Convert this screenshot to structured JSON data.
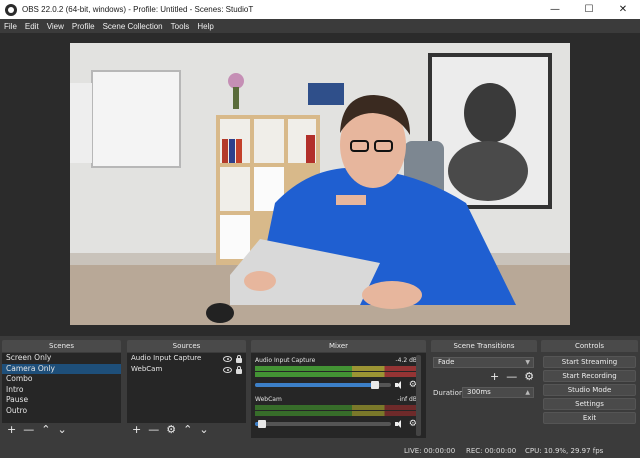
{
  "window": {
    "title": "OBS 22.0.2 (64-bit, windows) - Profile: Untitled - Scenes: StudioT",
    "minimize": "—",
    "maximize": "☐",
    "close": "✕"
  },
  "menu": [
    "File",
    "Edit",
    "View",
    "Profile",
    "Scene Collection",
    "Tools",
    "Help"
  ],
  "docks": {
    "scenes": {
      "title": "Scenes",
      "items": [
        "Screen Only",
        "Camera Only",
        "Combo",
        "Intro",
        "Pause",
        "Outro"
      ],
      "selected": "Camera Only"
    },
    "sources": {
      "title": "Sources",
      "items": [
        "Audio Input Capture",
        "WebCam"
      ]
    },
    "mixer": {
      "title": "Mixer",
      "channels": [
        {
          "name": "Audio Input Capture",
          "level": "-4.2 dB",
          "volume": 0.88
        },
        {
          "name": "WebCam",
          "level": "-inf dB",
          "volume": 0.05
        }
      ]
    },
    "transitions": {
      "title": "Scene Transitions",
      "selected": "Fade",
      "duration_label": "Duration",
      "duration_value": "300ms"
    },
    "controls": {
      "title": "Controls",
      "buttons": [
        "Start Streaming",
        "Start Recording",
        "Studio Mode",
        "Settings",
        "Exit"
      ]
    }
  },
  "toolbar_glyphs": {
    "add": "+",
    "remove": "—",
    "up": "⌃",
    "down": "⌄",
    "settings": "⚙"
  },
  "status": {
    "live": "LIVE: 00:00:00",
    "rec": "REC: 00:00:00",
    "cpu": "CPU: 10.9%, 29.97 fps"
  },
  "colors": {
    "background": "#3b3b3b",
    "panel": "#262626",
    "selection": "#1e4f7a",
    "fader": "#3c7fc7"
  }
}
